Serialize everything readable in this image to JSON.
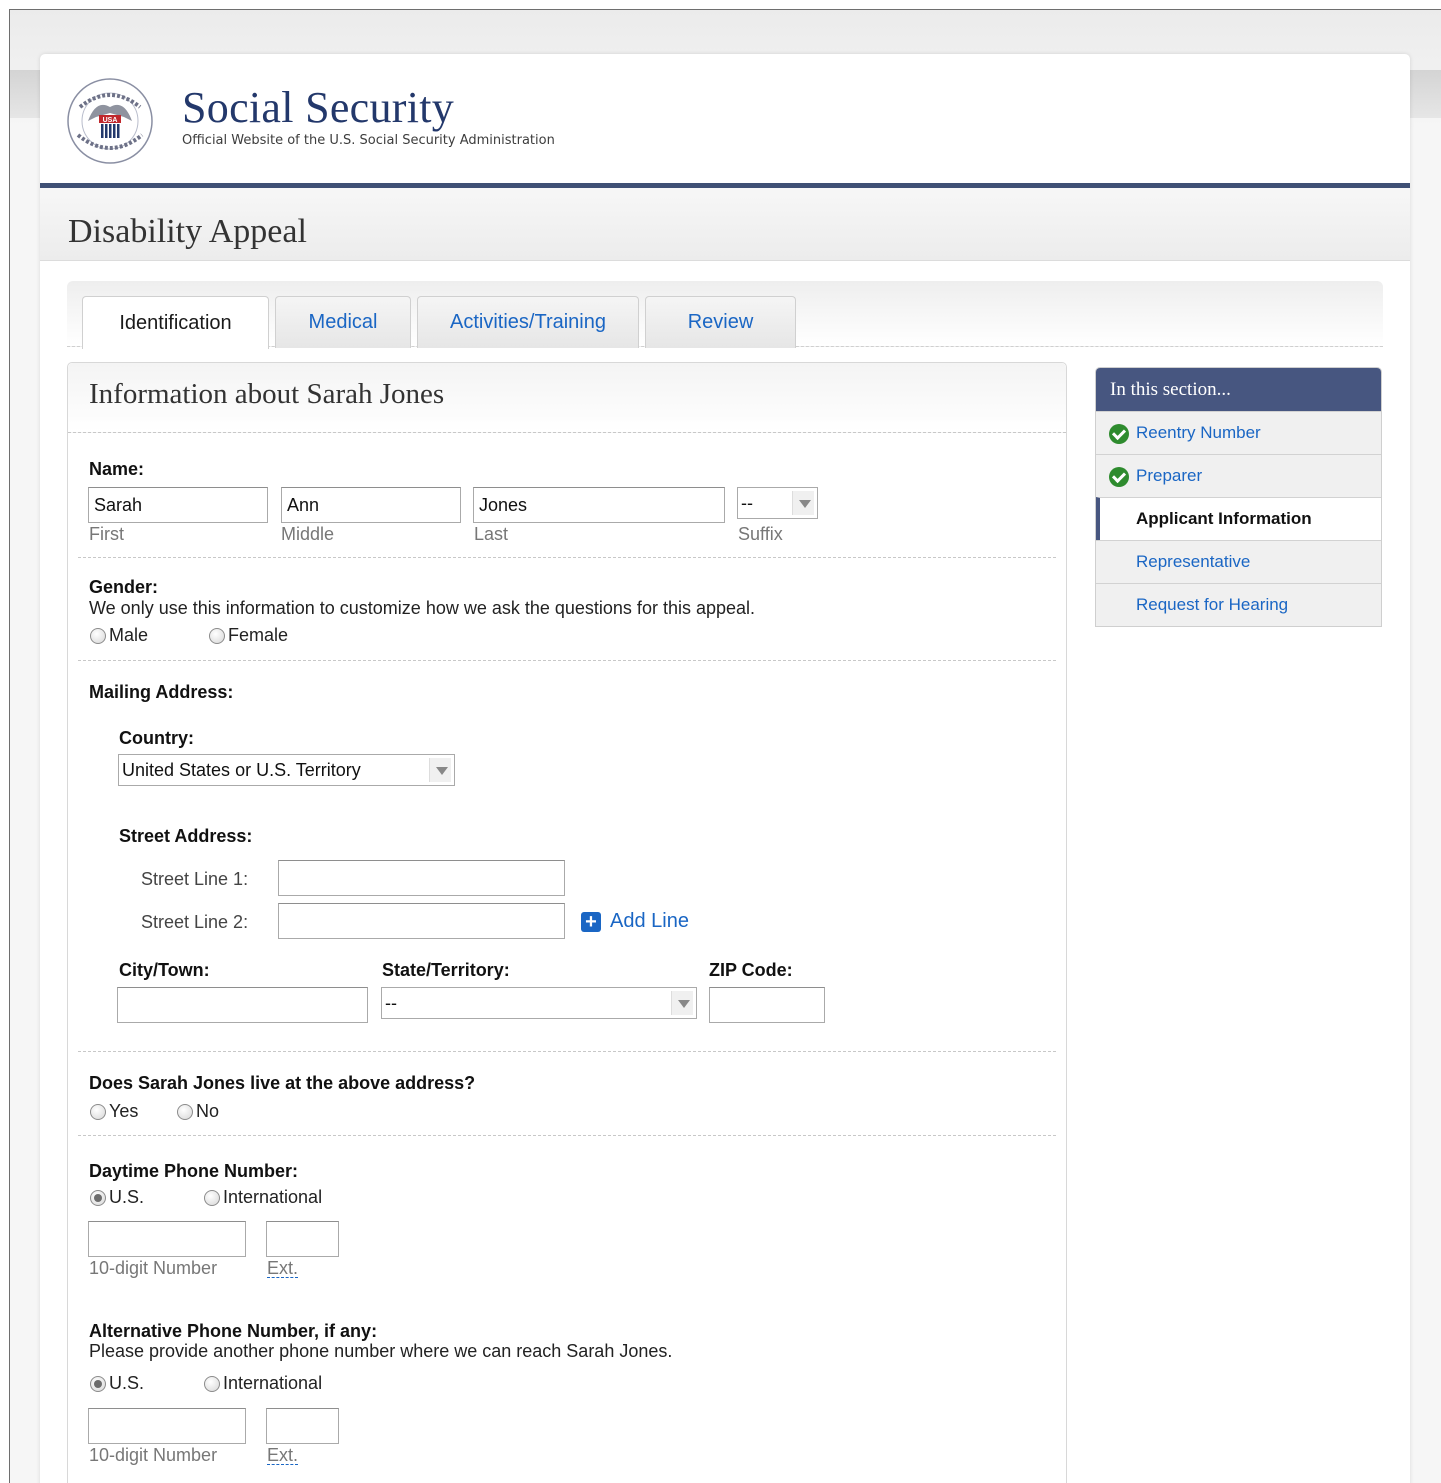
{
  "header": {
    "site_title": "Social Security",
    "site_subtitle": "Official Website of the U.S. Social Security Administration",
    "seal_text": "SOCIAL SECURITY ADMINISTRATION USA"
  },
  "app": {
    "title": "Disability Appeal"
  },
  "tabs": [
    {
      "label": "Identification",
      "active": true
    },
    {
      "label": "Medical",
      "active": false
    },
    {
      "label": "Activities/Training",
      "active": false
    },
    {
      "label": "Review",
      "active": false
    }
  ],
  "panel": {
    "title": "Information about Sarah Jones",
    "name": {
      "label": "Name:",
      "first": {
        "value": "Sarah",
        "caption": "First"
      },
      "middle": {
        "value": "Ann",
        "caption": "Middle"
      },
      "last": {
        "value": "Jones",
        "caption": "Last"
      },
      "suffix": {
        "value": "--",
        "caption": "Suffix"
      }
    },
    "gender": {
      "label": "Gender:",
      "help": "We only use this information to customize how we ask the questions for this appeal.",
      "options": [
        "Male",
        "Female"
      ]
    },
    "mailing": {
      "label": "Mailing Address:",
      "country_label": "Country:",
      "country_value": "United States or U.S. Territory",
      "street_label": "Street Address:",
      "line1_label": "Street Line 1:",
      "line2_label": "Street Line 2:",
      "add_line": "Add Line",
      "city_label": "City/Town:",
      "state_label": "State/Territory:",
      "state_value": "--",
      "zip_label": "ZIP Code:"
    },
    "lives_at": {
      "label": "Does Sarah Jones live at the above address?",
      "options": [
        "Yes",
        "No"
      ]
    },
    "daytime_phone": {
      "label": "Daytime Phone Number:",
      "options": [
        "U.S.",
        "International"
      ],
      "selected": "U.S.",
      "number_caption": "10-digit Number",
      "ext_caption": "Ext."
    },
    "alt_phone": {
      "label": "Alternative Phone Number, if any:",
      "help": "Please provide another phone number where we can reach Sarah Jones.",
      "options": [
        "U.S.",
        "International"
      ],
      "selected": "U.S.",
      "number_caption": "10-digit Number",
      "ext_caption": "Ext."
    }
  },
  "side_nav": {
    "title": "In this section...",
    "items": [
      {
        "label": "Reentry Number",
        "status": "complete"
      },
      {
        "label": "Preparer",
        "status": "complete"
      },
      {
        "label": "Applicant Information",
        "status": "current"
      },
      {
        "label": "Representative",
        "status": "pending"
      },
      {
        "label": "Request for Hearing",
        "status": "pending"
      }
    ]
  },
  "colors": {
    "brand_navy": "#23386b",
    "link_blue": "#1a66c4",
    "nav_header": "#475680",
    "check_green": "#2e8b2e"
  }
}
